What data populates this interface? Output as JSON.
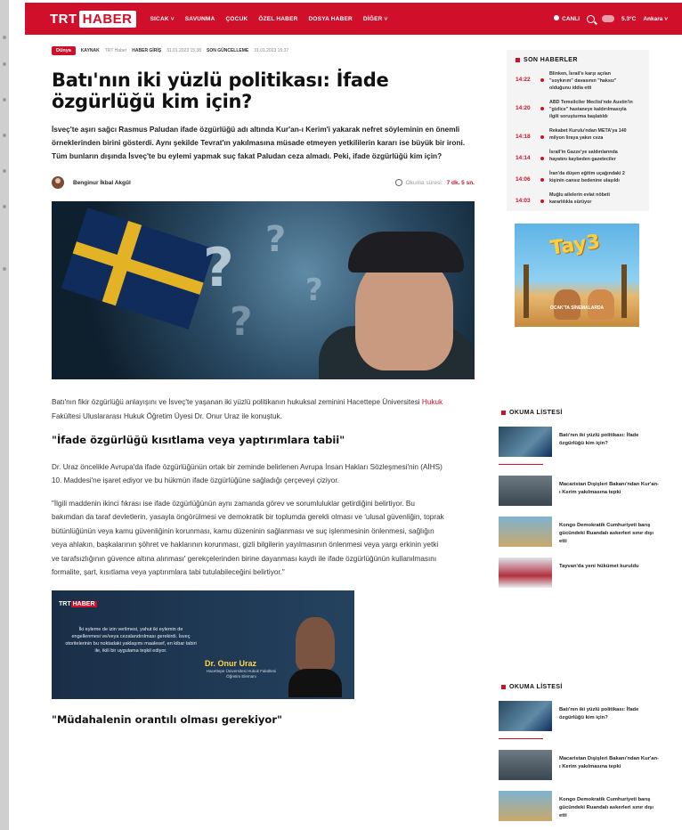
{
  "header": {
    "logo_trt": "TRT",
    "logo_haber": "HABER",
    "nav": [
      "SICAK ˅",
      "SAVUNMA",
      "ÇOCUK",
      "ÖZEL HABER",
      "DOSYA HABER",
      "DİĞER ˅"
    ],
    "live": "CANLI",
    "weather": "5.3°C",
    "city": "Ankara ˅",
    "brand_color": "#d0102a"
  },
  "article": {
    "category": "Dünya",
    "source_label": "KAYNAK",
    "source": "TRT Haber",
    "entry_label": "HABER GİRİŞ",
    "entry_date": "31.01.2023 15:38",
    "update_label": "SON GÜNCELLEME",
    "update_date": "31.01.2023 15:37",
    "title": "Batı'nın iki yüzlü politikası: İfade özgürlüğü kim için?",
    "lead": "İsveç'te aşırı sağcı Rasmus Paludan ifade özgürlüğü adı altında Kur'an-ı Kerim'i yakarak nefret söyleminin en önemli örneklerinden birini gösterdi. Aynı şekilde Tevrat'ın yakılmasına müsade etmeyen yetkililerin kararı ise büyük bir ironi. Tüm bunların dışında İsveç'te bu eylemi yapmak suç fakat Paludan ceza almadı. Peki, ifade özgürlüğü kim için?",
    "author": "Benginur İkbal Akgül",
    "read_label": "Okuma süresi:",
    "read_time": "7 dk. 5 sn.",
    "p1_a": "Batı'nın fikir özgürlüğü anlayışını ve İsveç'te yaşanan iki yüzlü politikanın hukuksal zeminini Hacettepe Üniversitesi ",
    "p1_link": "Hukuk",
    "p1_b": " Fakültesi Uluslararası Hukuk Öğretim Üyesi Dr. Onur Uraz ile konuştuk.",
    "h2_1": "\"İfade özgürlüğü kısıtlama veya yaptırımlara tabii\"",
    "p2": "Dr. Uraz öncelikle Avrupa'da ifade özgürlüğünün ortak bir zeminde belirlenen Avrupa İnsan Hakları Sözleşmesi'nin (AİHS) 10. Maddesi'ne işaret ediyor ve bu hükmün ifade özgürlüğüne sağladığı çerçeveyi çiziyor.",
    "p3": "\"İlgili maddenin ikinci fıkrası ise ifade özgürlüğünün aynı zamanda görev ve sorumluluklar getirdiğini belirtiyor. Bu bakımdan da taraf devletlerin, yasayla öngörülmesi ve demokratik bir toplumda gerekli olması ve 'ulusal güvenliğin, toprak bütünlüğünün veya kamu güvenliğinin korunması, kamu düzeninin sağlanması ve suç işlenmesinin önlenmesi, sağlığın veya ahlakın, başkalarının şöhret ve haklarının korunması, gizli bilgilerin yayılmasının önlenmesi veya yargı erkinin yetki ve tarafsızlığının güvence altına alınması' gerekçelerinden birine dayanması kaydı ile ifade özgürlüğünün kullanılmasını formalite, şart, kısıtlama veya yaptırımlara tabi tutulabileceğini belirtiyor.\"",
    "promo_logo_trt": "TRT",
    "promo_logo_haber": "HABER",
    "promo_quote": "İki eyleme de izin verilmesi, yahut iki eylemin de engellenmesi ve/veya cezalandırılması gerekirdi. İsveç otoritelerinin bu noktadaki yaklaşımı maalesef, en kibar tabiri ile, ikili bir uygulama teşkil ediyor.",
    "promo_name": "Dr. Onur Uraz",
    "promo_title": "Hacettepe Üniversitesi Hukuk Fakültesi Öğretim Elemanı",
    "h2_2": "\"Müdahalenin orantılı olması gerekiyor\""
  },
  "sidebar": {
    "latest_title": "SON HABERLER",
    "latest": [
      {
        "time": "14:22",
        "text": "Blinken, İsrail'e karşı açılan \"soykırım\" davasının \"haksız\" olduğunu iddia etti"
      },
      {
        "time": "14:20",
        "text": "ABD Temsilciler Meclisi'nde Austin'in \"gizlice\" hastaneye kaldırılmasıyla ilgili soruşturma başlatıldı"
      },
      {
        "time": "14:18",
        "text": "Rekabet Kurulu'ndan META'ya 140 milyon liraya yakın ceza"
      },
      {
        "time": "14:14",
        "text": "İsrail'in Gazze'ye saldırılarında hayatını kaybeden gazeteciler"
      },
      {
        "time": "14:06",
        "text": "İran'da düşen eğitim uçağındaki 2 kişinin cansız bedenine ulaşıldı"
      },
      {
        "time": "14:03",
        "text": "Muğlu ailelerin evlat nöbeti kararlılıkla sürüyor"
      }
    ],
    "ad_title": "Tay3",
    "ad_strip": "OCAK'TA SİNEMALARDA",
    "reading_title": "OKUMA LİSTESİ",
    "reading": [
      "Batı'nın iki yüzlü politikası: İfade özgürlüğü kim için?",
      "Macaristan Dışişleri Bakanı'ndan Kur'an-ı Kerim yakılmasına tepki",
      "Kongo Demokratik Cumhuriyeti barış gücündeki Ruandalı askerleri sınır dışı etti",
      "Tayvan'da yeni hükümet kuruldu"
    ],
    "reading2": [
      "Batı'nın iki yüzlü politikası: İfade özgürlüğü kim için?",
      "Macaristan Dışişleri Bakanı'ndan Kur'an-ı Kerim yakılmasına tepki",
      "Kongo Demokratik Cumhuriyeti barış gücündeki Ruandalı askerleri sınır dışı etti"
    ]
  }
}
